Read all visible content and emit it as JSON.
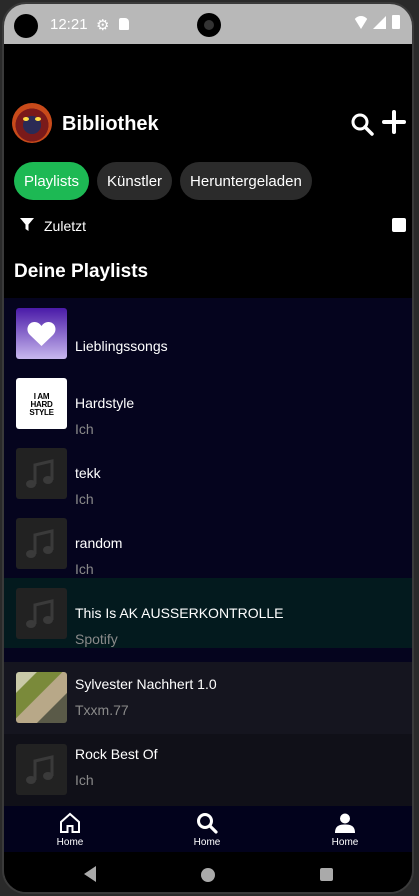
{
  "status_bar": {
    "time": "12:21"
  },
  "header": {
    "title": "Bibliothek"
  },
  "filters": [
    {
      "label": "Playlists",
      "active": true
    },
    {
      "label": "Künstler",
      "active": false
    },
    {
      "label": "Heruntergeladen",
      "active": false
    }
  ],
  "sort": {
    "label": "Zuletzt"
  },
  "section": {
    "title": "Deine Playlists"
  },
  "playlists": [
    {
      "title": "Lieblingssongs",
      "subtitle": "",
      "cover": "heart-gradient"
    },
    {
      "title": "Hardstyle",
      "subtitle": "Ich",
      "cover": "i-am-hardstyle",
      "cover_text": [
        "I AM",
        "HARD",
        "STYLE"
      ]
    },
    {
      "title": "tekk",
      "subtitle": "Ich",
      "cover": "music-note"
    },
    {
      "title": "random",
      "subtitle": "Ich",
      "cover": "music-note"
    },
    {
      "title": "This Is AK AUSSERKONTROLLE",
      "subtitle": "Spotify",
      "cover": "music-note",
      "highlighted": true
    },
    {
      "title": "Sylvester Nachhert 1.0",
      "subtitle": "Txxm.77",
      "cover": "photo"
    },
    {
      "title": "Rock Best Of",
      "subtitle": "Ich",
      "cover": "music-note"
    }
  ],
  "bottom_nav": [
    {
      "label": "Home",
      "icon": "home-icon"
    },
    {
      "label": "Home",
      "icon": "search-icon"
    },
    {
      "label": "Home",
      "icon": "profile-icon"
    }
  ],
  "colors": {
    "accent": "#1db954",
    "list_background": "#05041e",
    "highlight_row": "#031a1e",
    "photo_row": "#15151f",
    "last_row": "#101018",
    "chip_background": "#2b2b2b",
    "subtitle": "#8a8a8a"
  }
}
